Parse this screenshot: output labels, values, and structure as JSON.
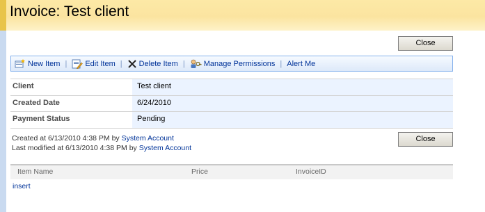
{
  "page": {
    "title": "Invoice: Test client"
  },
  "buttons": {
    "close_label": "Close"
  },
  "toolbar": {
    "new_item": "New Item",
    "edit_item": "Edit Item",
    "delete_item": "Delete Item",
    "manage_permissions": "Manage Permissions",
    "alert_me": "Alert Me",
    "separator": "|"
  },
  "fields": [
    {
      "label": "Client",
      "value": "Test client"
    },
    {
      "label": "Created Date",
      "value": "6/24/2010"
    },
    {
      "label": "Payment Status",
      "value": "Pending"
    }
  ],
  "meta": {
    "created_prefix": "Created at 6/13/2010 4:38 PM  by",
    "created_by": "System Account",
    "modified_prefix": "Last modified at 6/13/2010 4:38 PM  by",
    "modified_by": "System Account"
  },
  "grid": {
    "columns": [
      "Item Name",
      "Price",
      "InvoiceID"
    ],
    "insert_label": "insert"
  },
  "colors": {
    "title_bar": "#fbe4a0",
    "toolbar_border": "#83b0ec",
    "value_bg": "#ebf3ff",
    "link": "#003399"
  }
}
